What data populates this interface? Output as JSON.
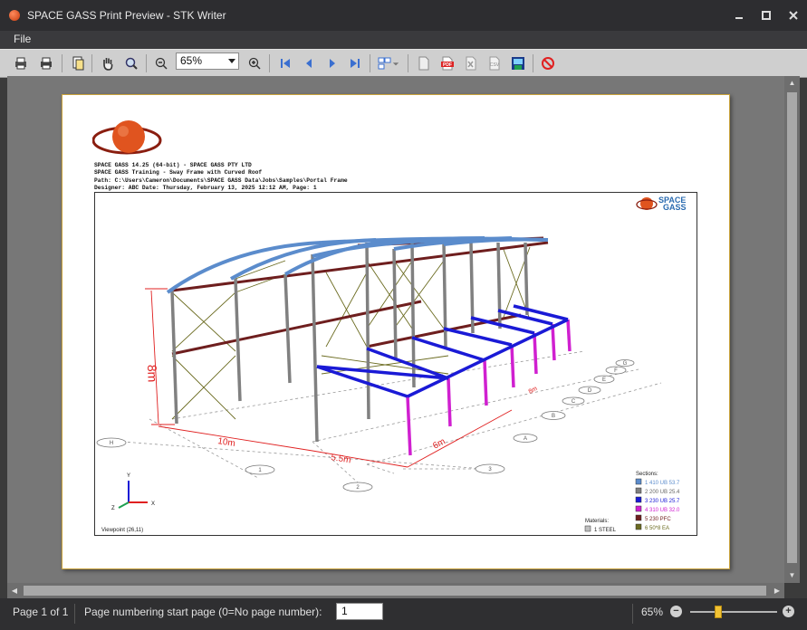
{
  "window": {
    "title": "SPACE GASS Print Preview - STK Writer",
    "minimize_icon": "minimize-icon",
    "maximize_icon": "maximize-icon",
    "close_icon": "close-icon"
  },
  "menu": {
    "file_label": "File"
  },
  "toolbar": {
    "zoom_value": "65%",
    "icons": [
      "print-setup-icon",
      "print-icon",
      "page-setup-icon",
      "pan-hand-icon",
      "zoom-magnifier-icon",
      "zoom-out-icon",
      "zoom-in-icon",
      "first-page-icon",
      "previous-page-icon",
      "next-page-icon",
      "last-page-icon",
      "multi-page-icon",
      "export-document-icon",
      "export-pdf-icon",
      "export-excel-icon",
      "export-csv-icon",
      "export-image-icon",
      "close-preview-icon"
    ]
  },
  "page": {
    "header_lines": [
      "SPACE GASS 14.25 (64-bit) - SPACE GASS PTY LTD",
      "SPACE GASS Training - Sway Frame with Curved Roof",
      "Path: C:\\Users\\Cameron\\Documents\\SPACE GASS Data\\Jobs\\Samples\\Portal Frame",
      "Designer: ABC Date: Thursday, February 13, 2025 12:12 AM, Page: 1"
    ],
    "inner_logo_line1": "SPACE",
    "inner_logo_line2": "GASS",
    "dimension_height": "8m",
    "dimension_10m": "10m",
    "dimension_5_5m": "5.5m",
    "dimension_6m": "6m",
    "dimension_rear": "8m",
    "grid_labels": [
      "1",
      "2",
      "3",
      "A",
      "B",
      "C",
      "D",
      "E",
      "F",
      "G",
      "H"
    ],
    "axis_x": "X",
    "axis_y": "Y",
    "axis_z": "Z",
    "viewpoint": "Viewpoint (26,11)",
    "materials_title": "Materials:",
    "materials": [
      {
        "label": "1  STEEL",
        "color": "#c0c0c0"
      }
    ],
    "sections_title": "Sections:",
    "sections": [
      {
        "label": "1  410 UB 53.7",
        "color": "#5b8ccc"
      },
      {
        "label": "2  200 UB 25.4",
        "color": "#808080"
      },
      {
        "label": "3  230 UB 25.7",
        "color": "#1a1ad6"
      },
      {
        "label": "4  310 UB 32.0",
        "color": "#d020d0"
      },
      {
        "label": "5  230 PFC",
        "color": "#6e1e1e"
      },
      {
        "label": "6  50*8 EA",
        "color": "#6b6b20"
      }
    ]
  },
  "statusbar": {
    "page_of": "Page 1 of 1",
    "numbering_label": "Page numbering start page (0=No page number):",
    "numbering_value": "1",
    "zoom_percent": "65%",
    "zoom_slider_fraction": 0.32
  },
  "colors": {
    "toolbar_bg": "#cfcfcf",
    "viewport_bg": "#777777",
    "page_border": "#c9a23a",
    "rafter": "#5b8ccc",
    "column": "#808080",
    "beam_blue": "#1a1ad6",
    "column_magenta": "#d020d0",
    "girt": "#6e1e1e",
    "brace": "#6b6b20",
    "dimension": "#e02020"
  }
}
